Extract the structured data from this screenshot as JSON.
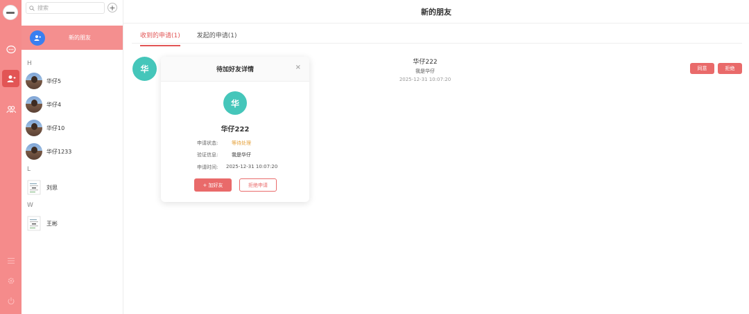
{
  "search": {
    "placeholder": "搜索"
  },
  "contacts": {
    "add_label": "+",
    "new_friends_label": "新的朋友",
    "groups": [
      {
        "letter": "H",
        "items": [
          "华仔5",
          "华仔4",
          "华仔10",
          "华仔1233"
        ]
      },
      {
        "letter": "L",
        "items": [
          "刘思"
        ]
      },
      {
        "letter": "W",
        "items": [
          "王彬"
        ]
      }
    ]
  },
  "main": {
    "title": "新的朋友",
    "tabs": [
      {
        "label": "收到的申请(1)",
        "active": true
      },
      {
        "label": "发起的申请(1)",
        "active": false
      }
    ]
  },
  "request": {
    "avatar_char": "华",
    "name": "华仔222",
    "message": "我是华仔",
    "time": "2025-12-31 10:07:20",
    "agree_label": "同意",
    "reject_label": "拒绝"
  },
  "dialog": {
    "title": "待加好友详情",
    "close": "×",
    "avatar_char": "华",
    "name": "华仔222",
    "status_key": "申请状态:",
    "status_value": "等待处理",
    "msg_key": "验证信息:",
    "msg_value": "我是华仔",
    "time_key": "申请时间:",
    "time_value": "2025-12-31 10:07:20",
    "add_label": "+ 加好友",
    "reject_label": "拒绝申请"
  },
  "colors": {
    "accent": "#e25555",
    "rail": "#f58b8b",
    "button": "#e96a6a",
    "avatar": "#45c6ba",
    "status": "#e6a23c"
  }
}
